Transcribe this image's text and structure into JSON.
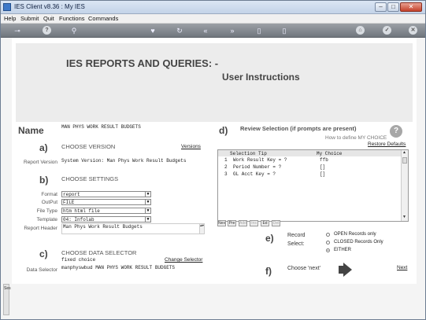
{
  "window": {
    "title": "IES Client v8.36 : My IES"
  },
  "menu": [
    "Help",
    "Submit",
    "Quit",
    "Functions",
    "Commands"
  ],
  "toolbar": {
    "icons": [
      "key-icon",
      "help-icon",
      "search-icon",
      "heart-icon",
      "refresh-icon",
      "rewind-icon",
      "forward-icon",
      "stop-icon",
      "stop-icon-2",
      "home-icon",
      "check-icon",
      "close-icon"
    ]
  },
  "header": {
    "title": "IES REPORTS AND QUERIES: -",
    "subtitle": "User Instructions"
  },
  "name": {
    "label": "Name",
    "value": "MAN PHYS WORK RESULT BUDGETS"
  },
  "section_a": {
    "letter": "a)",
    "heading": "CHOOSE VERSION",
    "link": "Versions",
    "row_label": "Report Version",
    "value": "System Version: Man Phys Work Result Budgets"
  },
  "section_b": {
    "letter": "b)",
    "heading": "CHOOSE SETTINGS",
    "rows": [
      {
        "label": "Format",
        "value": "report"
      },
      {
        "label": "OutPut",
        "value": "FILE"
      },
      {
        "label": "File Type",
        "value": "htm html file"
      },
      {
        "label": "Template",
        "value": "04: Infolab"
      }
    ],
    "report_header_label": "Report Header",
    "report_header_value": "Man Phys Work Result Budgets"
  },
  "section_c": {
    "letter": "c)",
    "heading": "CHOOSE DATA SELECTOR",
    "choice": "fixed choice",
    "link": "Change Selector",
    "row_label": "Data Selector",
    "value": "manphyswbud MAN PHYS WORK RESULT BUDGETS"
  },
  "section_d": {
    "letter": "d)",
    "heading": "Review Selection (if prompts are present)",
    "how_to": "How to define MY CHOICE",
    "restore": "Restore Defaults",
    "help": "?",
    "columns": [
      "Selection Tip",
      "My Choice"
    ],
    "rows": [
      {
        "n": "1",
        "tip": "Work Result Key = ?",
        "choice": "ffb"
      },
      {
        "n": "2",
        "tip": "Period Number = ?",
        "choice": "[]"
      },
      {
        "n": "3",
        "tip": "GL Acct Key = ?",
        "choice": "[]"
      }
    ],
    "grid_buttons": [
      "Nex",
      "Pre",
      "Add",
      "Ins",
      "Ed",
      "Del"
    ]
  },
  "section_e": {
    "letter": "e)",
    "label_1": "Record",
    "label_2": "Select:",
    "options": [
      "OPEN Records only",
      "CLOSED Records Only",
      "EITHER"
    ],
    "selected": 2
  },
  "section_f": {
    "letter": "f)",
    "label": "Choose 'next'",
    "link": "Next"
  },
  "sidebar": {
    "text": "Ses"
  },
  "colors": {
    "titlebar": "#c3d3e8",
    "toolbar": "#70767d",
    "band": "#ececec"
  }
}
